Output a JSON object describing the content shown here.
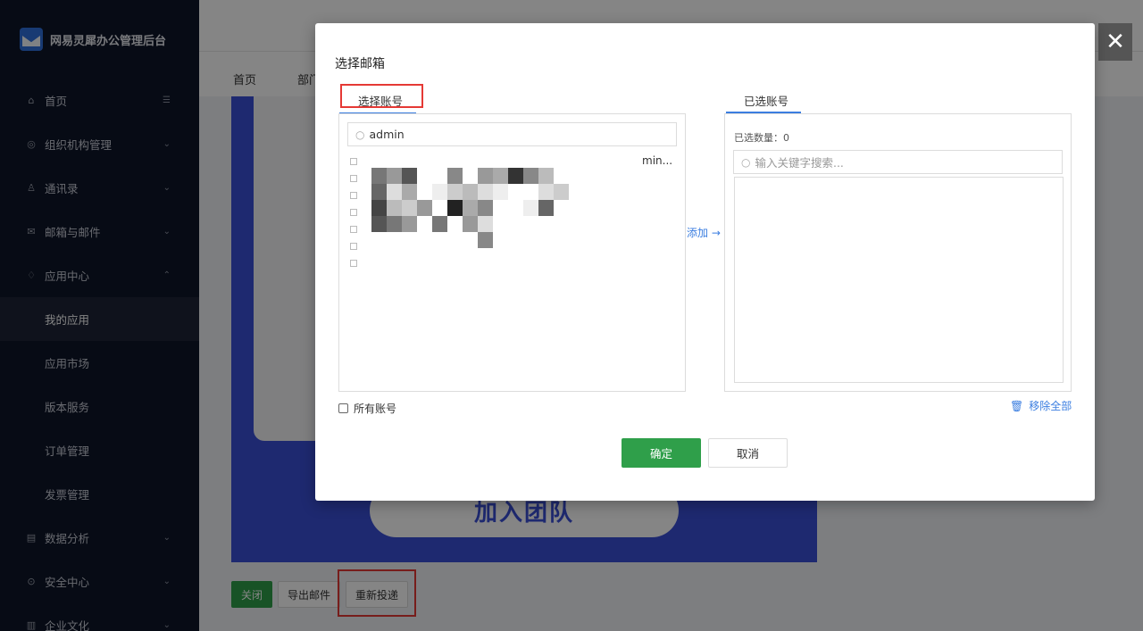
{
  "app": {
    "title": "网易灵犀办公管理后台"
  },
  "sidebar": {
    "items": [
      {
        "label": "首页",
        "icon": "home-icon",
        "glyph": "⌂",
        "trail": "☰"
      },
      {
        "label": "组织机构管理",
        "icon": "org-icon",
        "glyph": "◎",
        "trail": "⌄"
      },
      {
        "label": "通讯录",
        "icon": "contacts-icon",
        "glyph": "♙",
        "trail": "⌄"
      },
      {
        "label": "邮箱与邮件",
        "icon": "mail-icon",
        "glyph": "✉",
        "trail": "⌄"
      },
      {
        "label": "应用中心",
        "icon": "apps-icon",
        "glyph": "♢",
        "trail": "⌃"
      },
      {
        "label": "我的应用",
        "sub": true,
        "active": true
      },
      {
        "label": "应用市场",
        "sub": true
      },
      {
        "label": "版本服务",
        "sub": true
      },
      {
        "label": "订单管理",
        "sub": true
      },
      {
        "label": "发票管理",
        "sub": true
      },
      {
        "label": "数据分析",
        "icon": "analytics-icon",
        "glyph": "▤",
        "trail": "⌄"
      },
      {
        "label": "安全中心",
        "icon": "shield-icon",
        "glyph": "⊙",
        "trail": "⌄"
      },
      {
        "label": "企业文化",
        "icon": "culture-icon",
        "glyph": "▥",
        "trail": "⌄"
      }
    ]
  },
  "background": {
    "tabs": [
      "首页",
      "部门"
    ],
    "poster_button": "加入团队",
    "actions": {
      "close": "关闭",
      "export": "导出邮件",
      "redeliver": "重新投递"
    }
  },
  "dialog": {
    "title": "选择邮箱",
    "left_tab": "选择账号",
    "right_tab": "已选账号",
    "search_value": "admin",
    "search_icon": "search-icon",
    "result_tail": "min...",
    "result_count": 7,
    "add_label": "添加 →",
    "selected_count": "已选数量：0",
    "keyword_placeholder": "输入关键字搜索...",
    "all_accounts_label": "所有账号",
    "remove_all_label": "移除全部",
    "ok_label": "确定",
    "cancel_label": "取消",
    "close_glyph": "✕"
  },
  "colors": {
    "primary_green": "#2f9f4a",
    "link_blue": "#3b7ee0",
    "sidebar_bg": "#0f1629",
    "highlight_red": "#e53935",
    "poster_blue": "#3b4fd6"
  }
}
